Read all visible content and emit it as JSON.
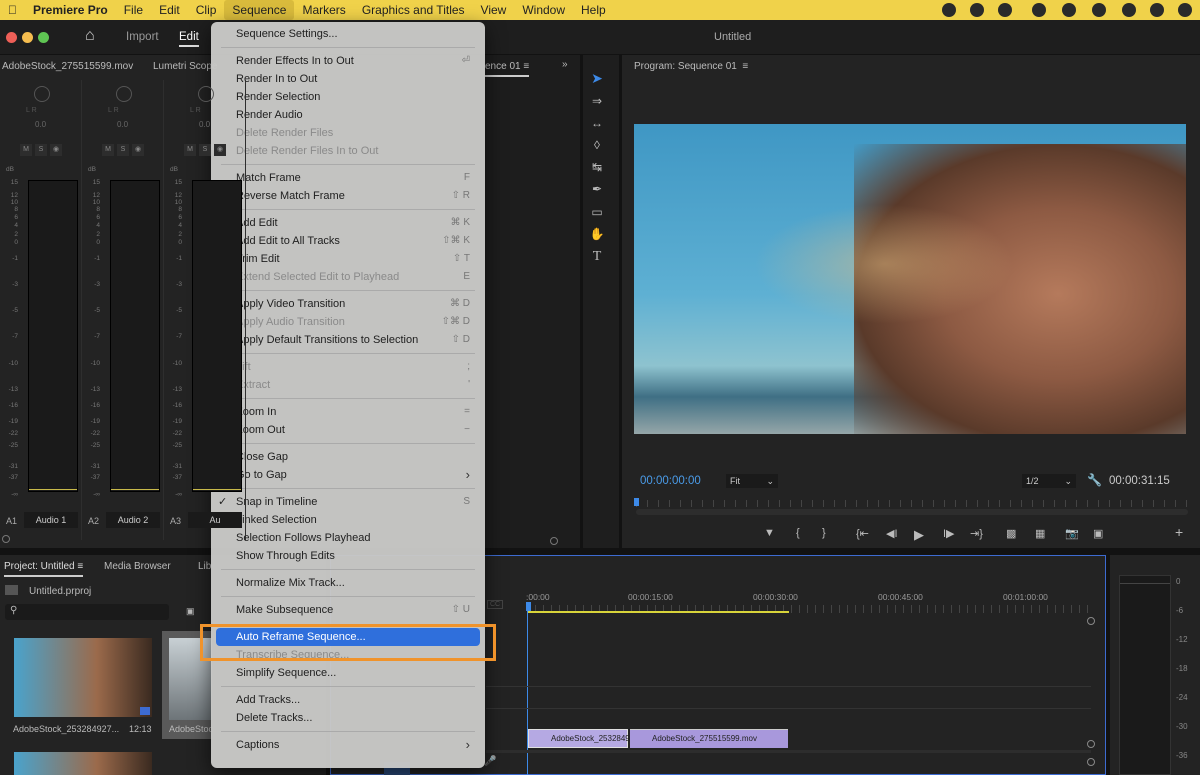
{
  "menubar": {
    "app": "Premiere Pro",
    "items": [
      "File",
      "Edit",
      "Clip",
      "Sequence",
      "Markers",
      "Graphics and Titles",
      "View",
      "Window",
      "Help"
    ],
    "active": "Sequence",
    "accent": "#f0d24a"
  },
  "titlebar": {
    "home_icon": "home-icon",
    "import": "Import",
    "edit": "Edit",
    "title": "Untitled"
  },
  "audio_mixer": {
    "tab1": "AdobeStock_275515599.mov",
    "tab2": "Lumetri Scope",
    "pan_label": "L    R",
    "pan_value": "0.0",
    "mute": "M",
    "solo": "S",
    "db_label": "dB",
    "scale": [
      "15",
      "12",
      "10",
      "8",
      "6",
      "4",
      "2",
      "0",
      "-1",
      "-3",
      "-5",
      "-7",
      "-10",
      "-13",
      "-16",
      "-19",
      "-22",
      "-25",
      "-31",
      "-37",
      "-∞"
    ],
    "tracks": [
      {
        "id": "A1",
        "name": "Audio 1"
      },
      {
        "id": "A2",
        "name": "Audio 2"
      },
      {
        "id": "A3",
        "name": "Au"
      }
    ]
  },
  "source": {
    "tab": "ence 01"
  },
  "program": {
    "title": "Program: Sequence 01",
    "timecode": "00:00:00:00",
    "fit": "Fit",
    "resolution": "1/2",
    "duration": "00:00:31:15",
    "timecode_color": "#4a9be8"
  },
  "project": {
    "tabs": [
      "Project: Untitled",
      "Media Browser",
      "Lib"
    ],
    "file": "Untitled.prproj",
    "items": [
      {
        "name": "AdobeStock_253284927...",
        "duration": "12:13"
      },
      {
        "name": "AdobeStoc"
      }
    ]
  },
  "timeline": {
    "ruler": [
      ":00:00",
      "00:00:15:00",
      "00:00:30:00",
      "00:00:45:00",
      "00:01:00:00"
    ],
    "clips": [
      "AdobeStock_2532849",
      "AdobeStock_275515599.mov"
    ],
    "clip_color": "#a898dc"
  },
  "master_meter": {
    "scale": [
      "0",
      "-6",
      "-12",
      "-18",
      "-24",
      "-30",
      "-36"
    ]
  },
  "menu": {
    "highlight_color": "#f0932b",
    "items": [
      {
        "label": "Sequence Settings..."
      },
      {
        "sep": true
      },
      {
        "label": "Render Effects In to Out",
        "shortcut": "⏎"
      },
      {
        "label": "Render In to Out"
      },
      {
        "label": "Render Selection"
      },
      {
        "label": "Render Audio"
      },
      {
        "label": "Delete Render Files",
        "disabled": true
      },
      {
        "label": "Delete Render Files In to Out",
        "disabled": true
      },
      {
        "sep": true
      },
      {
        "label": "Match Frame",
        "shortcut": "F"
      },
      {
        "label": "Reverse Match Frame",
        "shortcut": "⇧ R"
      },
      {
        "sep": true
      },
      {
        "label": "Add Edit",
        "shortcut": "⌘ K"
      },
      {
        "label": "Add Edit to All Tracks",
        "shortcut": "⇧⌘ K"
      },
      {
        "label": "Trim Edit",
        "shortcut": "⇧ T"
      },
      {
        "label": "Extend Selected Edit to Playhead",
        "shortcut": "E",
        "disabled": true
      },
      {
        "sep": true
      },
      {
        "label": "Apply Video Transition",
        "shortcut": "⌘ D"
      },
      {
        "label": "Apply Audio Transition",
        "shortcut": "⇧⌘ D",
        "disabled": true
      },
      {
        "label": "Apply Default Transitions to Selection",
        "shortcut": "⇧ D"
      },
      {
        "sep": true
      },
      {
        "label": "Lift",
        "shortcut": ";",
        "disabled": true
      },
      {
        "label": "Extract",
        "shortcut": "'",
        "disabled": true
      },
      {
        "sep": true
      },
      {
        "label": "Zoom In",
        "shortcut": "="
      },
      {
        "label": "Zoom Out",
        "shortcut": "−"
      },
      {
        "sep": true
      },
      {
        "label": "Close Gap"
      },
      {
        "label": "Go to Gap",
        "submenu": true
      },
      {
        "sep": true
      },
      {
        "label": "Snap in Timeline",
        "shortcut": "S",
        "checked": true
      },
      {
        "label": "Linked Selection",
        "checked": true
      },
      {
        "label": "Selection Follows Playhead"
      },
      {
        "label": "Show Through Edits"
      },
      {
        "sep": true
      },
      {
        "label": "Normalize Mix Track..."
      },
      {
        "sep": true
      },
      {
        "label": "Make Subsequence",
        "shortcut": "⇧ U"
      },
      {
        "label": "Auto Reframe Sequence...",
        "highlighted": true
      },
      {
        "label": "Transcribe Sequence...",
        "disabled": true
      },
      {
        "label": "Simplify Sequence..."
      },
      {
        "sep": true
      },
      {
        "label": "Add Tracks..."
      },
      {
        "label": "Delete Tracks..."
      },
      {
        "sep": true
      },
      {
        "label": "Captions",
        "submenu": true
      }
    ]
  }
}
